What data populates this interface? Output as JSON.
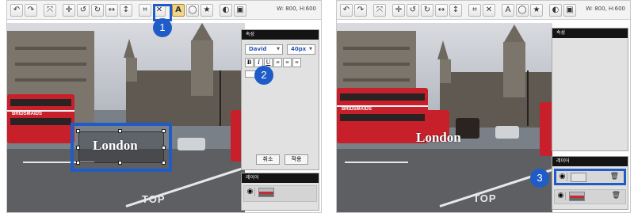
{
  "toolbar": {
    "size_readout": "W: 800, H:600"
  },
  "canvas": {
    "text_layer": "London",
    "road_markings": "TOP"
  },
  "bus": {
    "advert": "BRIDSMAIDS"
  },
  "properties_panel": {
    "title": "속성",
    "font_family": "David",
    "font_size": "40px",
    "bold": "B",
    "italic": "I",
    "underline": "U",
    "cancel_label": "취소",
    "apply_label": "적용"
  },
  "layers_panel": {
    "title": "레이어"
  },
  "steps": [
    "1",
    "2",
    "3"
  ],
  "colors": {
    "highlight": "#1f5cc8",
    "toolbar_active": "#f0d68a",
    "panel_header": "#141414"
  },
  "icons": {
    "toolbar": [
      "undo-icon",
      "redo-icon",
      "crop-icon",
      "move-icon",
      "rotate-icon",
      "flip-icon",
      "text-icon",
      "shape-icon",
      "star-icon",
      "contrast-icon",
      "image-icon"
    ],
    "layer": [
      "eye-icon",
      "trash-icon"
    ]
  }
}
